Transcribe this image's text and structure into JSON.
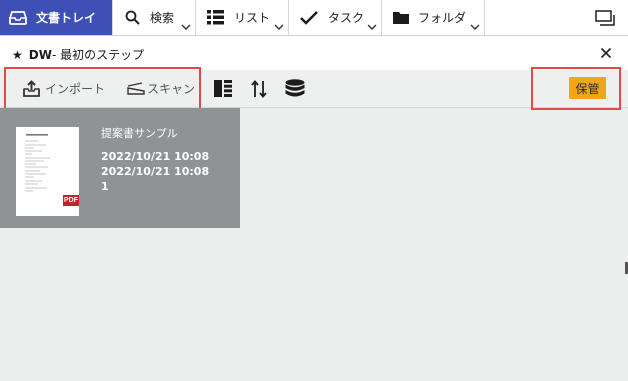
{
  "nav": {
    "tray_label": "文書トレイ",
    "search_label": "検索",
    "list_label": "リスト",
    "task_label": "タスク",
    "folder_label": "フォルダ"
  },
  "panel": {
    "star": "★",
    "title_bold": "DW",
    "title_rest": " - 最初のステップ"
  },
  "toolbar": {
    "import_label": "インポート",
    "scan_label": "スキャン",
    "save_label": "保管"
  },
  "document": {
    "name": "提案書サンプル",
    "created": "2022/10/21 10:08",
    "modified": "2022/10/21 10:08",
    "count": "1",
    "badge": "PDF"
  },
  "colors": {
    "accent": "#3e4fb6",
    "save_button": "#f2a51b",
    "highlight_border": "#e14b4b",
    "card_bg": "#8f9396",
    "pdf_badge": "#c0252b"
  },
  "icons": [
    "tray-icon",
    "search-icon",
    "list-icon",
    "checkmark-icon",
    "folder-icon",
    "window-icon",
    "close-icon",
    "import-icon",
    "scan-icon",
    "panel-layout-icon",
    "sort-icon",
    "database-icon"
  ]
}
